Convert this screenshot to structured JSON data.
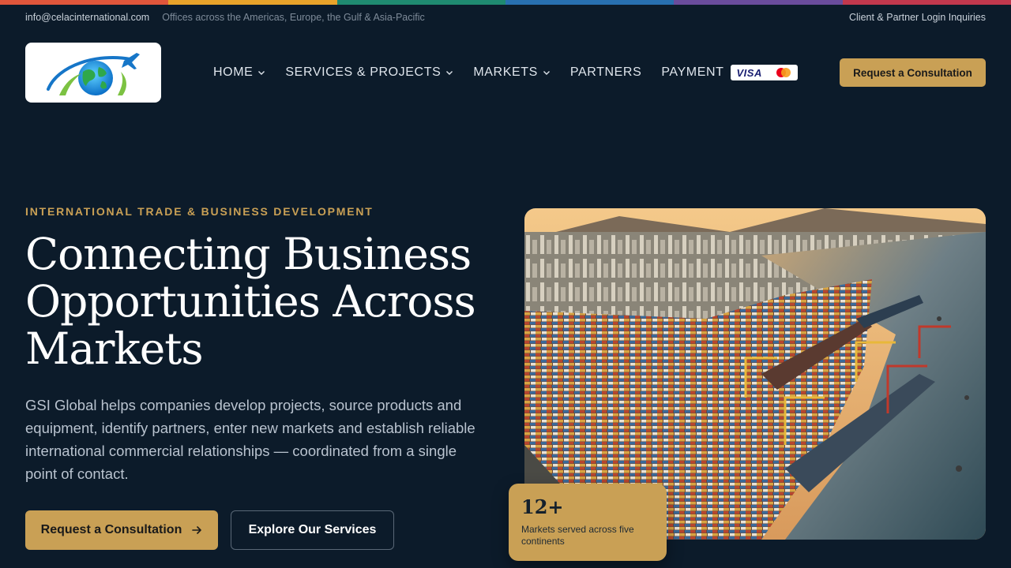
{
  "colors": {
    "background": "#0c1b2a",
    "accent_gold": "#c9a055",
    "strip": [
      "#e0563b",
      "#e8a32a",
      "#1f8a70",
      "#2870b0",
      "#6a4c9c",
      "#c2384d"
    ]
  },
  "topbar": {
    "email": "info@celacinternational.com",
    "offices": "Offices across the Americas, Europe, the Gulf & Asia-Pacific",
    "login": "Client & Partner Login Inquiries"
  },
  "logo": {
    "icon": "globe-airplane-logo-icon"
  },
  "nav": {
    "home": "HOME",
    "services": "SERVICES & PROJECTS",
    "markets": "MARKETS",
    "partners": "PARTNERS",
    "payment": "PAYMENT",
    "visa": "VISA"
  },
  "header_cta": "Request a Consultation",
  "hero": {
    "eyebrow": "INTERNATIONAL TRADE & BUSINESS DEVELOPMENT",
    "title": "Connecting Business Opportunities Across Markets",
    "description": "GSI Global helps companies develop projects, source products and equipment, identify partners, enter new markets and establish reliable international commercial relationships — coordinated from a single point of contact.",
    "primary_cta": "Request a Consultation",
    "secondary_cta": "Explore Our Services"
  },
  "stat": {
    "number": "12+",
    "label": "Markets served across five continents"
  }
}
